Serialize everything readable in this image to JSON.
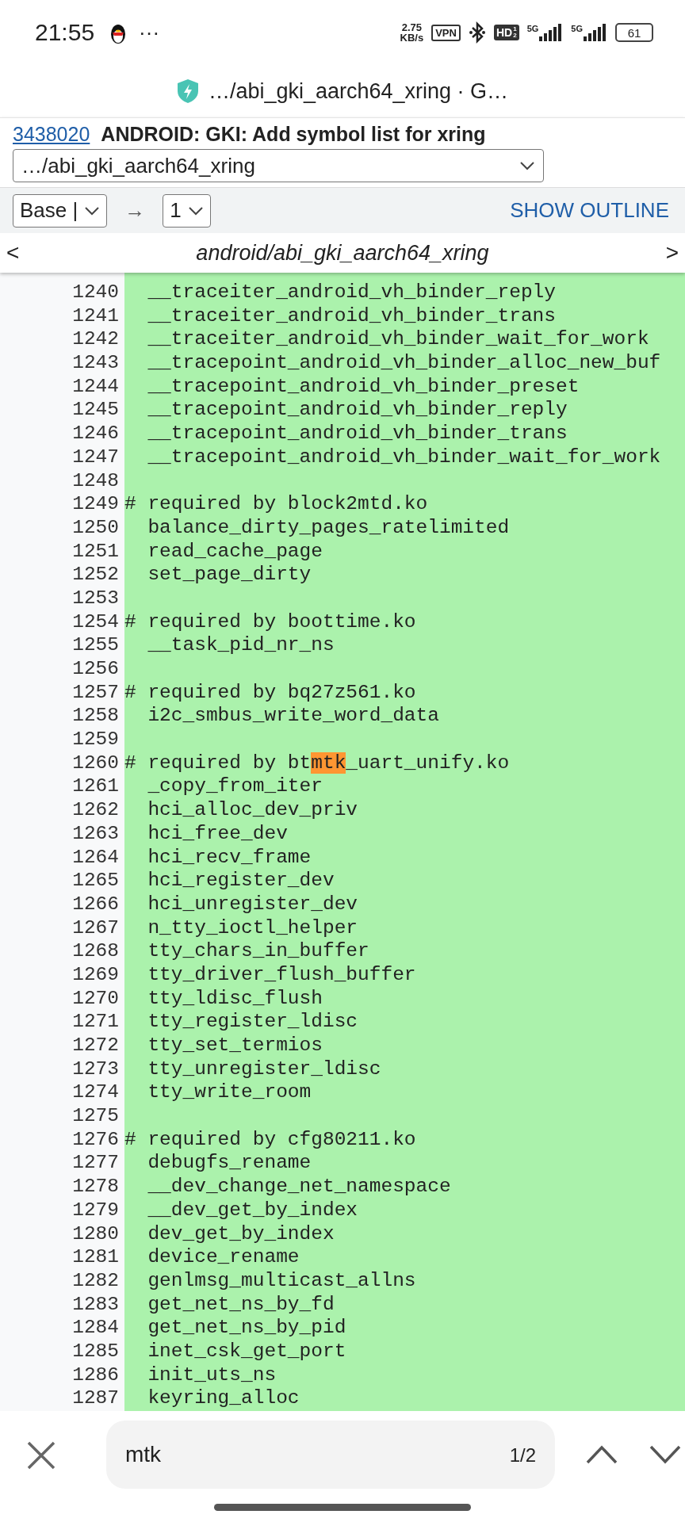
{
  "status_bar": {
    "time": "21:55",
    "more": "···",
    "speed_value": "2.75",
    "speed_unit": "KB/s",
    "vpn": "VPN",
    "hd": "HD",
    "hd_sup": "1",
    "hd_sub": "2",
    "networks": [
      "5G",
      "5G"
    ],
    "battery": "61"
  },
  "address_bar": {
    "title": "…/abi_gki_aarch64_xring · G…"
  },
  "change": {
    "number": "3438020",
    "subject": "ANDROID: GKI: Add symbol list for xring"
  },
  "file_select": {
    "value": "…/abi_gki_aarch64_xring"
  },
  "compare": {
    "base": "Base |",
    "arrow": "→",
    "patchset": "1",
    "outline": "SHOW OUTLINE"
  },
  "file_nav": {
    "prev": "<",
    "path": "android/abi_gki_aarch64_xring",
    "next": ">"
  },
  "lines": [
    {
      "number": "1240",
      "text": "  __traceiter_android_vh_binder_reply"
    },
    {
      "number": "1241",
      "text": "  __traceiter_android_vh_binder_trans"
    },
    {
      "number": "1242",
      "text": "  __traceiter_android_vh_binder_wait_for_work"
    },
    {
      "number": "1243",
      "text": "  __tracepoint_android_vh_binder_alloc_new_buf"
    },
    {
      "number": "1244",
      "text": "  __tracepoint_android_vh_binder_preset"
    },
    {
      "number": "1245",
      "text": "  __tracepoint_android_vh_binder_reply"
    },
    {
      "number": "1246",
      "text": "  __tracepoint_android_vh_binder_trans"
    },
    {
      "number": "1247",
      "text": "  __tracepoint_android_vh_binder_wait_for_work"
    },
    {
      "number": "1248"
    },
    {
      "number": "1249",
      "text": "# required by block2mtd.ko"
    },
    {
      "number": "1250",
      "text": "  balance_dirty_pages_ratelimited"
    },
    {
      "number": "1251",
      "text": "  read_cache_page"
    },
    {
      "number": "1252",
      "text": "  set_page_dirty"
    },
    {
      "number": "1253"
    },
    {
      "number": "1254",
      "text": "# required by boottime.ko"
    },
    {
      "number": "1255",
      "text": "  __task_pid_nr_ns"
    },
    {
      "number": "1256"
    },
    {
      "number": "1257",
      "text": "# required by bq27z561.ko"
    },
    {
      "number": "1258",
      "text": "  i2c_smbus_write_word_data"
    },
    {
      "number": "1259"
    },
    {
      "number": "1260",
      "segments": [
        {
          "text": "# required by bt",
          "highlighted": false
        },
        {
          "text": "mtk",
          "highlighted": true
        },
        {
          "text": "_uart_unify.ko",
          "highlighted": false
        }
      ]
    },
    {
      "number": "1261",
      "text": "  _copy_from_iter"
    },
    {
      "number": "1262",
      "text": "  hci_alloc_dev_priv"
    },
    {
      "number": "1263",
      "text": "  hci_free_dev"
    },
    {
      "number": "1264",
      "text": "  hci_recv_frame"
    },
    {
      "number": "1265",
      "text": "  hci_register_dev"
    },
    {
      "number": "1266",
      "text": "  hci_unregister_dev"
    },
    {
      "number": "1267",
      "text": "  n_tty_ioctl_helper"
    },
    {
      "number": "1268",
      "text": "  tty_chars_in_buffer"
    },
    {
      "number": "1269",
      "text": "  tty_driver_flush_buffer"
    },
    {
      "number": "1270",
      "text": "  tty_ldisc_flush"
    },
    {
      "number": "1271",
      "text": "  tty_register_ldisc"
    },
    {
      "number": "1272",
      "text": "  tty_set_termios"
    },
    {
      "number": "1273",
      "text": "  tty_unregister_ldisc"
    },
    {
      "number": "1274",
      "text": "  tty_write_room"
    },
    {
      "number": "1275"
    },
    {
      "number": "1276",
      "text": "# required by cfg80211.ko"
    },
    {
      "number": "1277",
      "text": "  debugfs_rename"
    },
    {
      "number": "1278",
      "text": "  __dev_change_net_namespace"
    },
    {
      "number": "1279",
      "text": "  __dev_get_by_index"
    },
    {
      "number": "1280",
      "text": "  dev_get_by_index"
    },
    {
      "number": "1281",
      "text": "  device_rename"
    },
    {
      "number": "1282",
      "text": "  genlmsg_multicast_allns"
    },
    {
      "number": "1283",
      "text": "  get_net_ns_by_fd"
    },
    {
      "number": "1284",
      "text": "  get_net_ns_by_pid"
    },
    {
      "number": "1285",
      "text": "  inet_csk_get_port"
    },
    {
      "number": "1286",
      "text": "  init_uts_ns"
    },
    {
      "number": "1287",
      "text": "  keyring_alloc"
    }
  ],
  "find_bar": {
    "query": "mtk",
    "count": "1/2"
  }
}
